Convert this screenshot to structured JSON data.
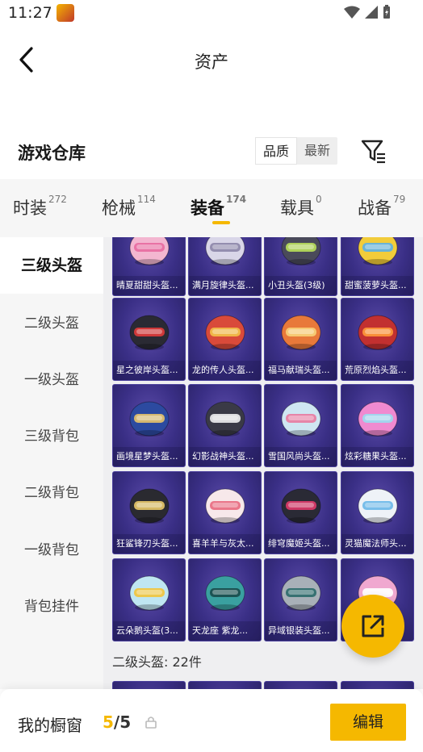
{
  "status": {
    "time": "11:27"
  },
  "header": {
    "title": "资产"
  },
  "section": {
    "title": "游戏仓库",
    "sort_quality": "品质",
    "sort_latest": "最新"
  },
  "tabs": [
    {
      "label": "时装",
      "count": "272"
    },
    {
      "label": "枪械",
      "count": "114"
    },
    {
      "label": "装备",
      "count": "174"
    },
    {
      "label": "载具",
      "count": "0"
    },
    {
      "label": "战备",
      "count": "79"
    }
  ],
  "categories": [
    "三级头盔",
    "二级头盔",
    "一级头盔",
    "三级背包",
    "二级背包",
    "一级背包",
    "背包挂件"
  ],
  "items": [
    {
      "name": "晴夏甜甜头盔...",
      "color": "#f3b6d0",
      "accent": "#e86aa0"
    },
    {
      "name": "满月旋律头盔...",
      "color": "#d9d6e8",
      "accent": "#8c86a8"
    },
    {
      "name": "小丑头盔(3级)",
      "color": "#4a4a5a",
      "accent": "#b9e05a"
    },
    {
      "name": "甜蜜菠萝头盔...",
      "color": "#f2cc3a",
      "accent": "#5ab0e8"
    },
    {
      "name": "星之彼岸头盔...",
      "color": "#2a2a33",
      "accent": "#e03a3a"
    },
    {
      "name": "龙的传人头盔...",
      "color": "#d94a3a",
      "accent": "#f2c14a"
    },
    {
      "name": "福马献瑞头盔...",
      "color": "#e8793a",
      "accent": "#f7d27a"
    },
    {
      "name": "荒原烈焰头盔...",
      "color": "#c23030",
      "accent": "#ff9a3a"
    },
    {
      "name": "画境星梦头盔...",
      "color": "#2c4aa0",
      "accent": "#e8c46a"
    },
    {
      "name": "幻影战神头盔...",
      "color": "#3a3a46",
      "accent": "#f0f0f0"
    },
    {
      "name": "雪国风尚头盔...",
      "color": "#cfe6f2",
      "accent": "#e87aa0"
    },
    {
      "name": "炫彩糖果头盔...",
      "color": "#f08ad0",
      "accent": "#9adcf0"
    },
    {
      "name": "狂鲨锋刃头盔...",
      "color": "#2a2a30",
      "accent": "#e8c86a"
    },
    {
      "name": "喜羊羊与灰太...",
      "color": "#f7e8ea",
      "accent": "#e86a80"
    },
    {
      "name": "绯穹魔姬头盔...",
      "color": "#2a2a35",
      "accent": "#e03a6a"
    },
    {
      "name": "灵猫魔法师头...",
      "color": "#eef2f7",
      "accent": "#6ab8e8"
    },
    {
      "name": "云朵鹅头盔(3...",
      "color": "#bfe6f2",
      "accent": "#f2c43a"
    },
    {
      "name": "天龙座 紫龙...",
      "color": "#3aa0a0",
      "accent": "#1a4a4a"
    },
    {
      "name": "异域银装头盔...",
      "color": "#a8b0b8",
      "accent": "#2a6a6a"
    },
    {
      "name": "",
      "color": "#f0a8d0",
      "accent": "#ffffff"
    }
  ],
  "sub_section": "二级头盔: 22件",
  "bottom": {
    "label": "我的橱窗",
    "current": "5",
    "total": "/5",
    "edit_label": "编辑"
  },
  "colors": {
    "accent": "#f5b800",
    "card_bg": "#3a2f86"
  }
}
